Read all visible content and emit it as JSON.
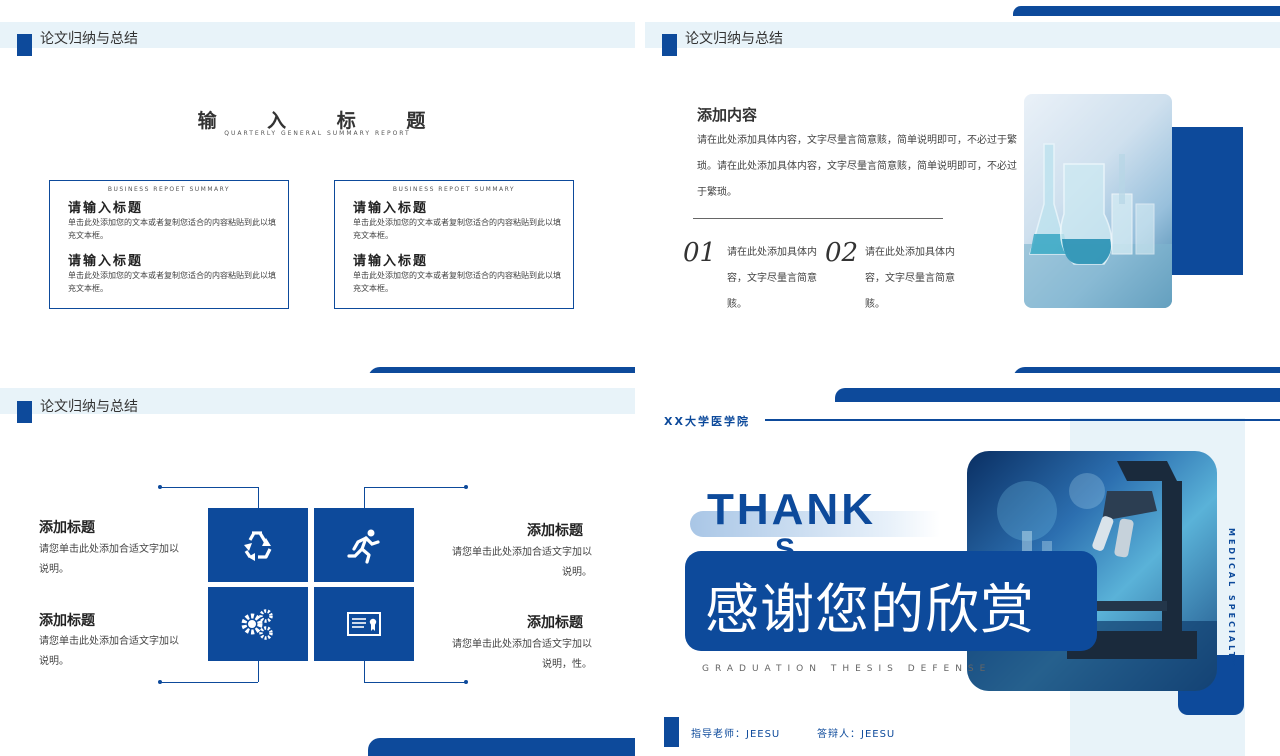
{
  "section_title": "论文归纳与总结",
  "slide1": {
    "title": "输 入 标 题",
    "subtitle": "QUARTERLY GENERAL SUMMARY REPORT",
    "cards": [
      {
        "tag": "BUSINESS REPOET SUMMARY",
        "items": [
          {
            "heading": "请输入标题",
            "text": "单击此处添加您的文本或者复制您适合的内容粘贴到此以填充文本框。"
          },
          {
            "heading": "请输入标题",
            "text": "单击此处添加您的文本或者复制您适合的内容粘贴到此以填充文本框。"
          }
        ]
      },
      {
        "tag": "BUSINESS REPOET SUMMARY",
        "items": [
          {
            "heading": "请输入标题",
            "text": "单击此处添加您的文本或者复制您适合的内容粘贴到此以填充文本框。"
          },
          {
            "heading": "请输入标题",
            "text": "单击此处添加您的文本或者复制您适合的内容粘贴到此以填充文本框。"
          }
        ]
      }
    ]
  },
  "slide2": {
    "heading": "添加内容",
    "paragraph": "请在此处添加具体内容，文字尽量言简意赅，简单说明即可，不必过于繁琐。请在此处添加具体内容，文字尽量言简意赅，简单说明即可，不必过于繁琐。",
    "points": [
      {
        "num": "01",
        "text": "请在此处添加具体内容，文字尽量言简意赅。"
      },
      {
        "num": "02",
        "text": "请在此处添加具体内容，文字尽量言简意赅。"
      }
    ]
  },
  "slide3": {
    "left": [
      {
        "heading": "添加标题",
        "text": "请您单击此处添加合适文字加以说明。"
      },
      {
        "heading": "添加标题",
        "text": "请您单击此处添加合适文字加以说明。"
      }
    ],
    "right": [
      {
        "heading": "添加标题",
        "text": "请您单击此处添加合适文字加以说明。"
      },
      {
        "heading": "添加标题",
        "text": "请您单击此处添加合适文字加以说明，性。"
      }
    ],
    "icons": [
      "recycle-icon",
      "runner-icon",
      "gears-icon",
      "certificate-icon"
    ]
  },
  "slide4": {
    "school": "XX大学医学院",
    "thank": "THANK",
    "thank_partial": "S",
    "banner": "感谢您的欣赏",
    "english": "GRADUATION THESIS DEFENSE",
    "vertical": "MEDICAL SPECIALTY",
    "advisor": "指导老师：JEESU",
    "defender": "答辩人：JEESU"
  },
  "colors": {
    "primary": "#0d4a9b",
    "band": "#e8f3f9"
  }
}
